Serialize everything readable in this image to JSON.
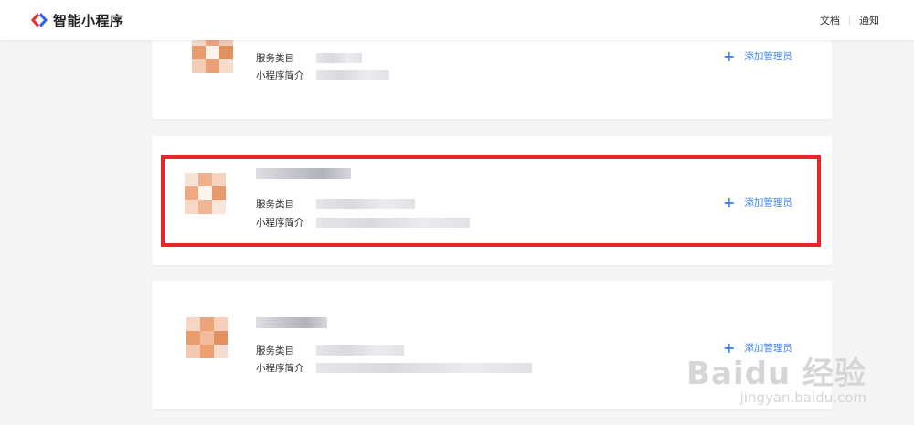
{
  "header": {
    "brand_title": "智能小程序",
    "links": [
      "文档",
      "通知"
    ],
    "brand_colors": {
      "red": "#e52e2e",
      "blue": "#2d64f0"
    }
  },
  "cards": [
    {
      "service_label": "服务类目",
      "intro_label": "小程序简介",
      "add_admin_label": "添加管理员"
    },
    {
      "service_label": "服务类目",
      "intro_label": "小程序简介",
      "add_admin_label": "添加管理员"
    },
    {
      "service_label": "服务类目",
      "intro_label": "小程序简介",
      "add_admin_label": "添加管理员"
    }
  ],
  "highlight_color": "#e8262a",
  "link_color": "#3f86f5"
}
